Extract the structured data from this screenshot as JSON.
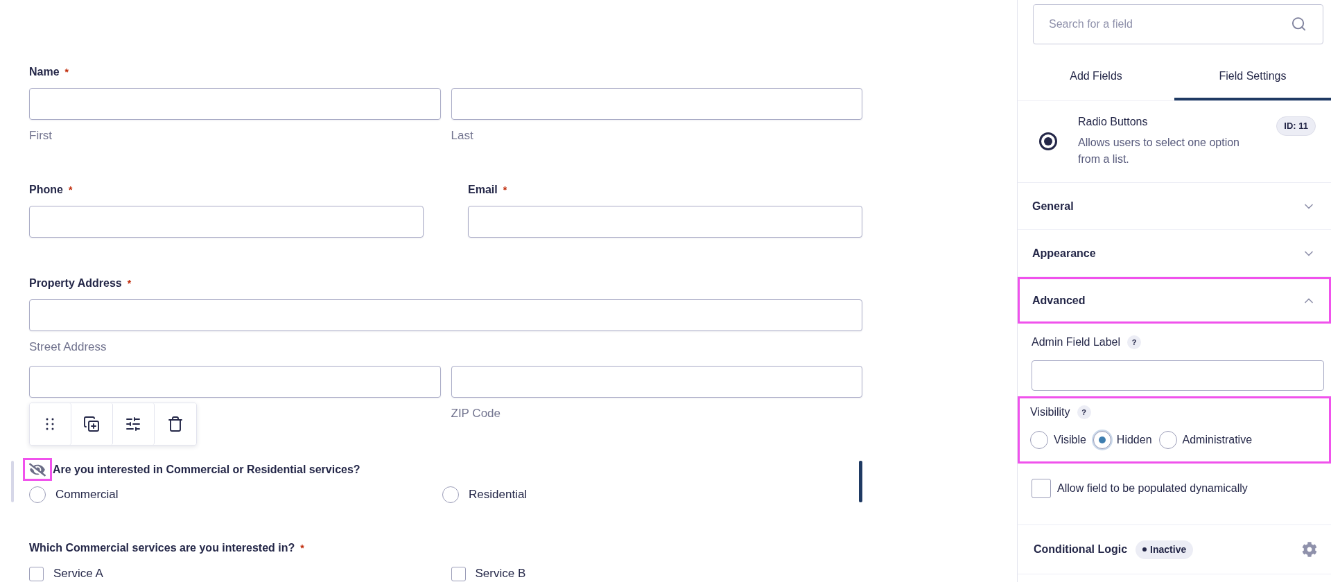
{
  "form": {
    "name_field": {
      "label": "Name",
      "required_mark": "*",
      "sublabels": [
        "First",
        "Last"
      ]
    },
    "contact_fields": [
      {
        "label": "Phone",
        "required_mark": "*"
      },
      {
        "label": "Email",
        "required_mark": "*"
      }
    ],
    "address_field": {
      "label": "Property Address",
      "required_mark": "*",
      "street_sublabel": "Street Address",
      "zip_sublabel": "ZIP Code"
    },
    "service_type_field": {
      "label": "Are you interested in Commercial or Residential services?",
      "hidden": true,
      "hidden_icon_highlighted": true,
      "selected": true,
      "toolbar": [
        {
          "kind": "drag"
        },
        {
          "kind": "duplicate"
        },
        {
          "kind": "settings"
        },
        {
          "kind": "delete"
        }
      ],
      "options": [
        {
          "label": "Commercial",
          "selected": false
        },
        {
          "label": "Residential",
          "selected": false
        }
      ]
    },
    "services_field": {
      "label": "Which Commercial services are you interested in?",
      "required_mark": "*",
      "options": [
        {
          "label": "Service A",
          "checked": false
        },
        {
          "label": "Service B",
          "checked": false
        }
      ]
    }
  },
  "sidebar": {
    "search": {
      "placeholder": "Search for a field"
    },
    "tabs": [
      {
        "label": "Add Fields",
        "selected": false
      },
      {
        "label": "Field Settings",
        "selected": true
      }
    ],
    "field_info": {
      "title": "Radio Buttons",
      "description": "Allows users to select one option from a list.",
      "id_badge": "ID: 11"
    },
    "sections": [
      {
        "kind": "accordion",
        "title": "General",
        "expanded": false,
        "highlighted": false
      },
      {
        "kind": "accordion",
        "title": "Appearance",
        "expanded": false,
        "highlighted": false
      },
      {
        "kind": "accordion",
        "title": "Advanced",
        "expanded": true,
        "highlighted": true,
        "settings": [
          {
            "kind": "text",
            "label": "Admin Field Label",
            "help_mark": "?"
          },
          {
            "kind": "radio",
            "label": "Visibility",
            "help_mark": "?",
            "highlighted": true,
            "options": [
              {
                "label": "Visible",
                "selected": false
              },
              {
                "label": "Hidden",
                "selected": true
              },
              {
                "label": "Administrative",
                "selected": false
              }
            ]
          },
          {
            "kind": "checkbox",
            "label": "Allow field to be populated dynamically",
            "checked": false
          }
        ]
      },
      {
        "kind": "logic",
        "title": "Conditional Logic",
        "status": "Inactive"
      }
    ]
  }
}
